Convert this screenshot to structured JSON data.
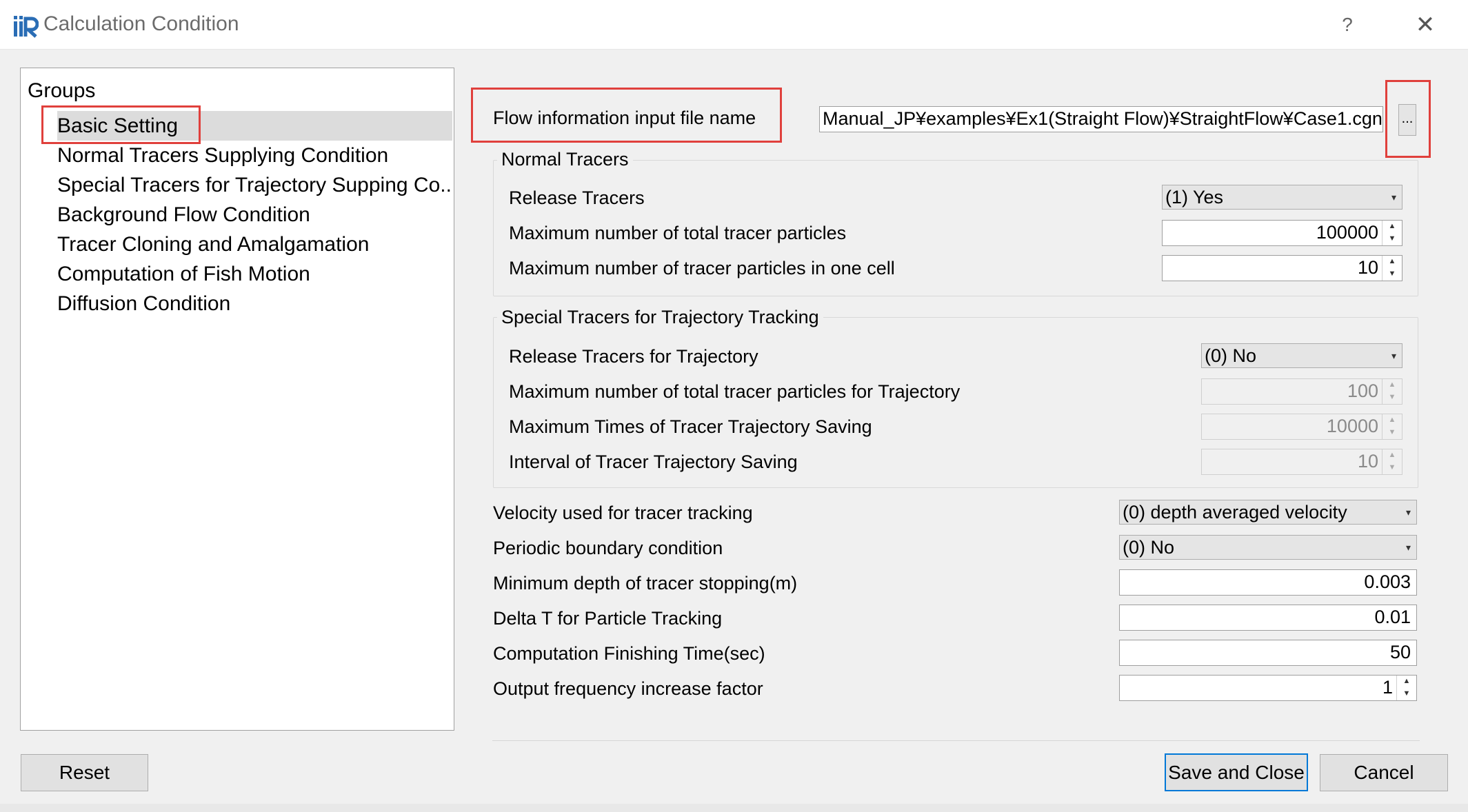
{
  "window": {
    "title": "Calculation Condition",
    "help_icon": "?",
    "close_icon": "✕"
  },
  "groups": {
    "title": "Groups",
    "items": [
      {
        "label": "Basic Setting",
        "selected": true
      },
      {
        "label": "Normal Tracers Supplying Condition"
      },
      {
        "label": "Special Tracers for Trajectory Supping Co..."
      },
      {
        "label": "Background Flow Condition"
      },
      {
        "label": "Tracer Cloning and Amalgamation"
      },
      {
        "label": "Computation of Fish Motion"
      },
      {
        "label": "Diffusion Condition"
      }
    ]
  },
  "basic": {
    "flow_file_label": "Flow information input file name",
    "flow_file_value": "Manual_JP¥examples¥Ex1(Straight Flow)¥StraightFlow¥Case1.cgn",
    "browse_label": "..."
  },
  "normal_tracers": {
    "title": "Normal Tracers",
    "release_label": "Release Tracers",
    "release_value": "(1) Yes",
    "max_total_label": "Maximum number of total tracer particles",
    "max_total_value": "100000",
    "max_cell_label": "Maximum number of tracer particles in one cell",
    "max_cell_value": "10"
  },
  "special_tracers": {
    "title": "Special Tracers for Trajectory Tracking",
    "release_label": "Release Tracers for Trajectory",
    "release_value": "(0) No",
    "max_total_label": "Maximum number of total tracer particles for Trajectory",
    "max_total_value": "100",
    "max_times_label": "Maximum Times of Tracer Trajectory Saving",
    "max_times_value": "10000",
    "interval_label": "Interval of Tracer Trajectory Saving",
    "interval_value": "10"
  },
  "general": {
    "velocity_label": "Velocity used for tracer tracking",
    "velocity_value": "(0) depth averaged velocity",
    "periodic_label": "Periodic boundary condition",
    "periodic_value": "(0) No",
    "min_depth_label": "Minimum depth of tracer stopping(m)",
    "min_depth_value": "0.003",
    "delta_t_label": "Delta T for Particle Tracking",
    "delta_t_value": "0.01",
    "finish_label": "Computation Finishing Time(sec)",
    "finish_value": "50",
    "output_label": "Output frequency increase factor",
    "output_value": "1"
  },
  "buttons": {
    "reset": "Reset",
    "save_close": "Save and Close",
    "cancel": "Cancel"
  },
  "colors": {
    "highlight_box": "#e0403c",
    "default_button_border": "#0078d7"
  }
}
